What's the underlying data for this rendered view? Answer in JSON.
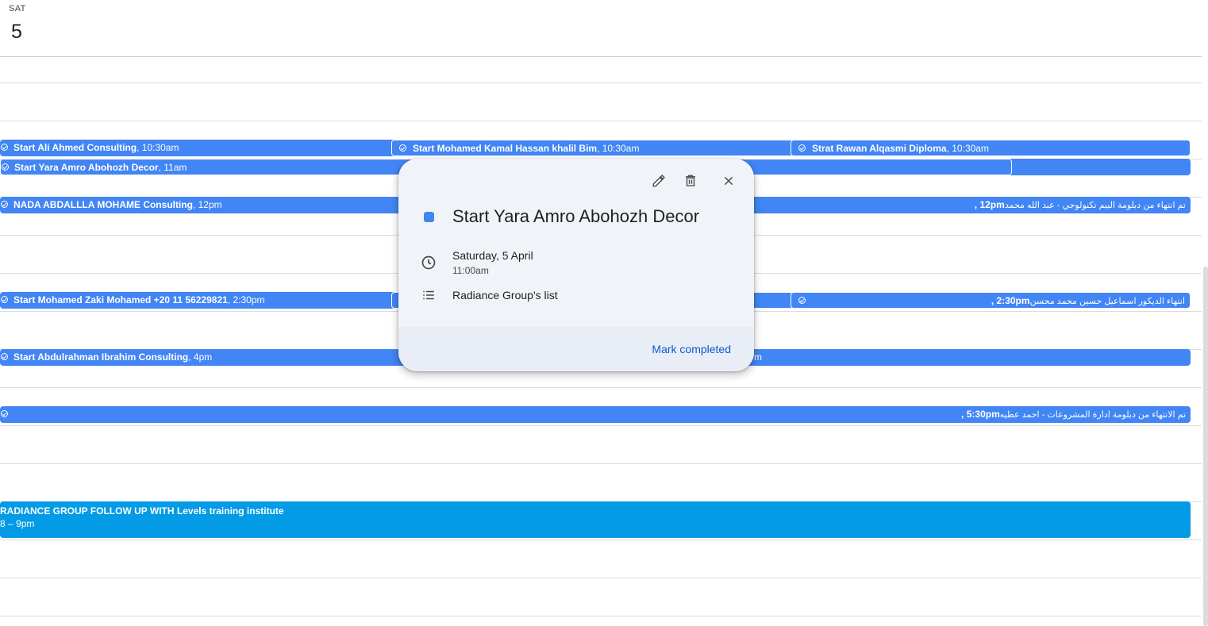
{
  "day": {
    "name": "SAT",
    "number": "5"
  },
  "events": {
    "r1a": {
      "title": "Start Ali Ahmed Consulting",
      "time": ", 10:30am"
    },
    "r1b": {
      "title": "Start Mohamed Kamal Hassan khalil Bim",
      "time": ", 10:30am"
    },
    "r1c": {
      "title": "Strat Rawan Alqasmi Diploma",
      "time": ", 10:30am"
    },
    "r2a": {
      "title": "Start Yara Amro Abohozh Decor",
      "time": ", 11am"
    },
    "r3a": {
      "title": "NADA ABDALLLA MOHAME Consulting",
      "time": ", 12pm"
    },
    "r3c": {
      "title": "تم انتهاء من دبلومة البيم تكنولوجي - عبد الله محمد",
      "time": "12pm ,"
    },
    "r4a": {
      "title": "Start Mohamed Zaki Mohamed +20 11 56229821",
      "time": ", 2:30pm"
    },
    "r4c": {
      "title": "انتهاء الديكور اسماعيل حسين محمد محسن",
      "time": "2:30pm ,"
    },
    "r5a": {
      "title": "Start Abdulrahman Ibrahim Consulting",
      "time": ", 4pm",
      "tail": "m"
    },
    "r6a": {
      "title": "تم الانتهاء من دبلومة ادارة المشروعات - احمد عطيه",
      "time": "5:30pm ,"
    },
    "big": {
      "title": "RADIANCE GROUP FOLLOW UP WITH Levels training institute",
      "time": "8 – 9pm"
    }
  },
  "popup": {
    "title": "Start Yara Amro Abohozh Decor",
    "date": "Saturday, 5 April",
    "time": "11:00am",
    "list": "Radiance Group's list",
    "mark_completed": "Mark completed",
    "color": "#4285f4",
    "icons": [
      "pencil-icon",
      "trash-icon",
      "close-icon",
      "clock-icon",
      "list-icon"
    ]
  },
  "colors": {
    "task_blue": "#4285f4",
    "event_blue": "#039be5",
    "link_blue": "#0b57d0"
  }
}
